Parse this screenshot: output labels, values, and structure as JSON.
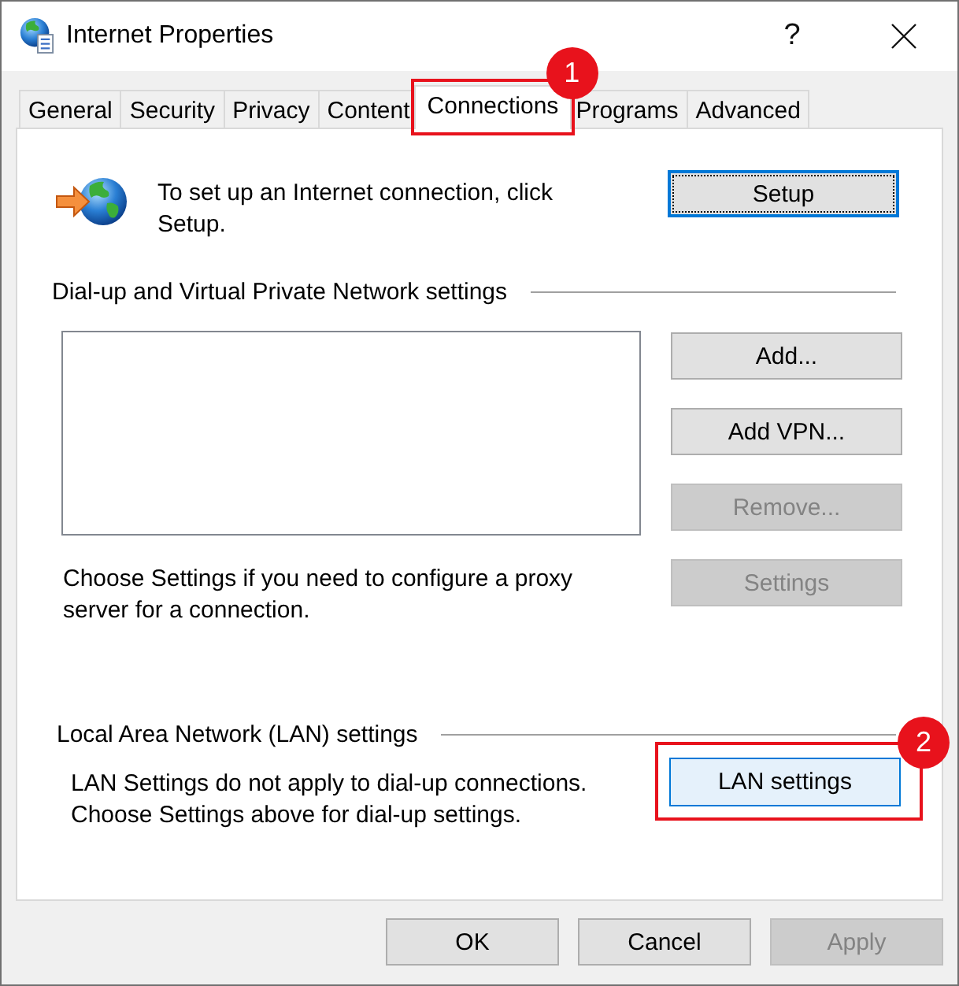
{
  "window": {
    "title": "Internet Properties",
    "help": "?"
  },
  "tabs": [
    {
      "label": "General",
      "selected": false
    },
    {
      "label": "Security",
      "selected": false
    },
    {
      "label": "Privacy",
      "selected": false
    },
    {
      "label": "Content",
      "selected": false
    },
    {
      "label": "Connections",
      "selected": true,
      "callout": "1"
    },
    {
      "label": "Programs",
      "selected": false
    },
    {
      "label": "Advanced",
      "selected": false
    }
  ],
  "setup": {
    "text": "To set up an Internet connection, click\nSetup.",
    "button": {
      "label": "Setup",
      "focused": true
    }
  },
  "dialup": {
    "heading": "Dial-up and Virtual Private Network settings",
    "buttons": [
      {
        "label": "Add...",
        "disabled": false
      },
      {
        "label": "Add VPN...",
        "disabled": false
      },
      {
        "label": "Remove...",
        "disabled": true
      },
      {
        "label": "Settings",
        "disabled": true
      }
    ],
    "proxy_text": "Choose Settings if you need to configure a proxy\nserver for a connection."
  },
  "lan": {
    "heading": "Local Area Network (LAN) settings",
    "text": "LAN Settings do not apply to dial-up connections.\nChoose Settings above for dial-up settings.",
    "button": {
      "label": "LAN settings",
      "hovered": true,
      "callout": "2"
    }
  },
  "footer_buttons": [
    {
      "label": "OK",
      "disabled": false
    },
    {
      "label": "Cancel",
      "disabled": false
    },
    {
      "label": "Apply",
      "disabled": true
    }
  ]
}
